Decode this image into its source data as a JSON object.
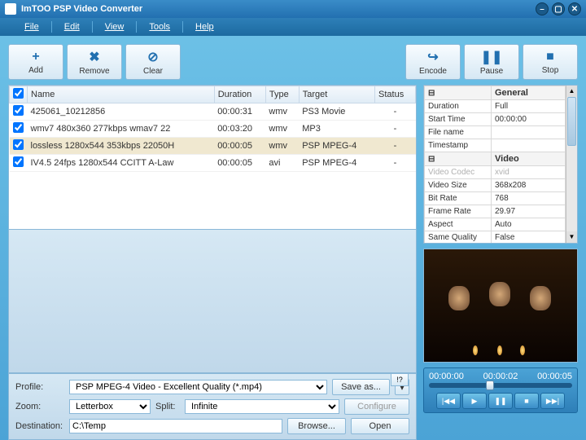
{
  "title": "ImTOO PSP Video Converter",
  "menu": [
    "File",
    "Edit",
    "View",
    "Tools",
    "Help"
  ],
  "toolbar_left": [
    {
      "icon": "+",
      "label": "Add",
      "name": "add-button"
    },
    {
      "icon": "✖",
      "label": "Remove",
      "name": "remove-button"
    },
    {
      "icon": "⊘",
      "label": "Clear",
      "name": "clear-button"
    }
  ],
  "toolbar_right": [
    {
      "icon": "↪",
      "label": "Encode",
      "name": "encode-button"
    },
    {
      "icon": "❚❚",
      "label": "Pause",
      "name": "pause-button"
    },
    {
      "icon": "■",
      "label": "Stop",
      "name": "stop-button"
    }
  ],
  "columns": [
    "",
    "Name",
    "Duration",
    "Type",
    "Target",
    "Status"
  ],
  "files": [
    {
      "name": "425061_10212856",
      "duration": "00:00:31",
      "type": "wmv",
      "target": "PS3 Movie",
      "status": "-"
    },
    {
      "name": "wmv7 480x360 277kbps wmav7 22",
      "duration": "00:03:20",
      "type": "wmv",
      "target": "MP3",
      "status": "-"
    },
    {
      "name": "lossless 1280x544 353kbps 22050H",
      "duration": "00:00:05",
      "type": "wmv",
      "target": "PSP MPEG-4",
      "status": "-",
      "selected": true
    },
    {
      "name": "IV4.5 24fps 1280x544 CCITT A-Law",
      "duration": "00:00:05",
      "type": "avi",
      "target": "PSP MPEG-4",
      "status": "-"
    }
  ],
  "props": {
    "groups": [
      {
        "name": "General",
        "rows": [
          {
            "k": "Duration",
            "v": "Full"
          },
          {
            "k": "Start Time",
            "v": "00:00:00"
          },
          {
            "k": "File name",
            "v": ""
          },
          {
            "k": "Timestamp",
            "v": ""
          }
        ]
      },
      {
        "name": "Video",
        "rows": [
          {
            "k": "Video Codec",
            "v": "xvid",
            "faded": true
          },
          {
            "k": "Video Size",
            "v": "368x208"
          },
          {
            "k": "Bit Rate",
            "v": "768"
          },
          {
            "k": "Frame Rate",
            "v": "29.97"
          },
          {
            "k": "Aspect",
            "v": "Auto"
          },
          {
            "k": "Same Quality",
            "v": "False"
          }
        ]
      }
    ]
  },
  "bottom": {
    "profile_label": "Profile:",
    "profile_value": "PSP MPEG-4 Video - Excellent Quality  (*.mp4)",
    "saveas": "Save as...",
    "zoom_label": "Zoom:",
    "zoom_value": "Letterbox",
    "split_label": "Split:",
    "split_value": "Infinite",
    "configure": "Configure",
    "dest_label": "Destination:",
    "dest_value": "C:\\Temp",
    "browse": "Browse...",
    "open": "Open"
  },
  "player": {
    "times": [
      "00:00:00",
      "00:00:02",
      "00:00:05"
    ]
  }
}
